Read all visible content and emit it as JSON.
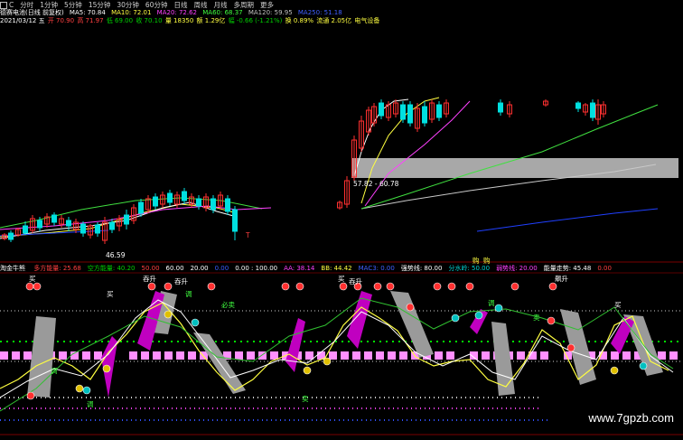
{
  "toolbar": {
    "first_box": "C",
    "tabs": [
      "分时",
      "1分钟",
      "5分钟",
      "15分钟",
      "30分钟",
      "60分钟",
      "日线",
      "周线",
      "月线",
      "多周期",
      "更多"
    ]
  },
  "info1": {
    "stock": "德赛电池(日线 前复权)",
    "ma5": "MA5: 70.84",
    "ma10": "MA10: 72.01",
    "ma20": "MA20: 72.62",
    "ma60": "MA60: 68.37",
    "ma120": "MA120: 59.95",
    "ma250": "MA250: 51.18"
  },
  "info2": {
    "date": "2021/03/12 五",
    "open": "开 70.90",
    "high": "高 71.97",
    "low": "低 69.00",
    "close": "收 70.10",
    "volume": "量 18350",
    "amount": "额 1.29亿",
    "change": "幅 -0.66 (-1.21%)",
    "turnover": "换 0.89%",
    "float_cap": "流通 2.05亿",
    "industry": "电气设备"
  },
  "main_chart": {
    "box_label": "57.82 - 60.78",
    "low_marker": "46.59",
    "t_marker": "T",
    "buy_labels": [
      "购",
      "购"
    ]
  },
  "indicator": {
    "name": "淘金牛熊",
    "fields": [
      {
        "label": "多方能量: 25.68",
        "color": "#ff4040"
      },
      {
        "label": "空方能量: 40.20",
        "color": "#00d000"
      },
      {
        "label": "50.00",
        "color": "#ff4040"
      },
      {
        "label": "60.00",
        "color": "#ffffff"
      },
      {
        "label": "20.00",
        "color": "#ffffff"
      },
      {
        "label": "0.00",
        "color": "#3a5cff"
      },
      {
        "label": "0.00 : 100.00",
        "color": "#ffffff"
      },
      {
        "label": "AA: 38.14",
        "color": "#ff40ff"
      },
      {
        "label": "BB: 44.42",
        "color": "#ffff40"
      },
      {
        "label": "MAC3: 0.00",
        "color": "#4060ff"
      },
      {
        "label": "强势线: 80.00",
        "color": "#ffffff"
      },
      {
        "label": "分水岭: 50.00",
        "color": "#00d0d0"
      },
      {
        "label": "弱势线: 20.00",
        "color": "#ff40ff"
      },
      {
        "label": "能量走势: 45.48",
        "color": "#ffffff"
      },
      {
        "label": "0.00",
        "color": "#ff4040"
      }
    ]
  },
  "sub_labels": {
    "buy": "买",
    "rise": "吞升",
    "sell": "卖",
    "adjust": "调",
    "must_sell": "必卖",
    "surge": "飙升"
  },
  "watermark": "www.7gpzb.com",
  "colors": {
    "up": "#ff3030",
    "down": "#00e0e0",
    "magenta": "#c000c0",
    "gray_band": "#9a9a9a"
  }
}
